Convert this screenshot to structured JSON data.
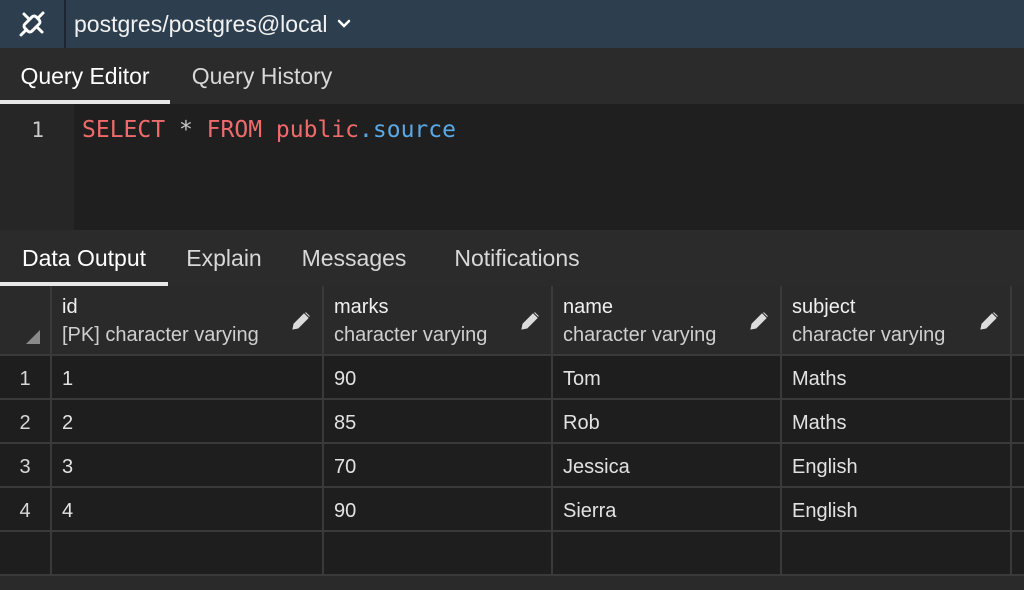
{
  "connection": {
    "label": "postgres/postgres@local",
    "icon": "connection-plug-icon",
    "chevron_icon": "chevron-down-icon"
  },
  "top_tabs": [
    {
      "label": "Query Editor",
      "active": true
    },
    {
      "label": "Query History",
      "active": false
    }
  ],
  "editor": {
    "line_number": "1",
    "tokens": {
      "select": "SELECT",
      "star": "*",
      "from": "FROM",
      "schema": "public",
      "dot": ".",
      "table": "source"
    }
  },
  "bottom_tabs": [
    {
      "label": "Data Output",
      "active": true
    },
    {
      "label": "Explain",
      "active": false
    },
    {
      "label": "Messages",
      "active": false
    },
    {
      "label": "Notifications",
      "active": false
    }
  ],
  "grid": {
    "columns": [
      {
        "name": "id",
        "type": "[PK] character varying"
      },
      {
        "name": "marks",
        "type": "character varying"
      },
      {
        "name": "name",
        "type": "character varying"
      },
      {
        "name": "subject",
        "type": "character varying"
      }
    ],
    "rows": [
      {
        "num": "1",
        "cells": [
          "1",
          "90",
          "Tom",
          "Maths"
        ]
      },
      {
        "num": "2",
        "cells": [
          "2",
          "85",
          "Rob",
          "Maths"
        ]
      },
      {
        "num": "3",
        "cells": [
          "3",
          "70",
          "Jessica",
          "English"
        ]
      },
      {
        "num": "4",
        "cells": [
          "4",
          "90",
          "Sierra",
          "English"
        ]
      }
    ]
  },
  "colors": {
    "connection_bar": "#2d3e4e",
    "keyword": "#ef6b6b",
    "identifier": "#5aa9e6"
  }
}
